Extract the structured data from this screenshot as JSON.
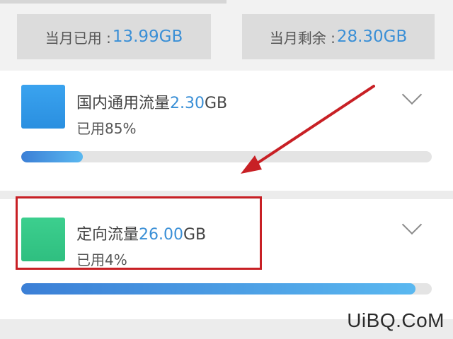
{
  "summary": {
    "used_label": "当月已用 :",
    "used_value": "13.99GB",
    "left_label": "当月剩余 :",
    "left_value": "28.30GB"
  },
  "cards": [
    {
      "title": "国内通用流量",
      "amount": "2.30",
      "unit": "GB",
      "usage_label": "已用85%",
      "icon_color": "#2a8fe0"
    },
    {
      "title": "定向流量",
      "amount": "26.00",
      "unit": "GB",
      "usage_label": "已用4%",
      "icon_color": "#2fbf80"
    }
  ],
  "colors": {
    "accent": "#3a8fd6",
    "highlight": "#c82025"
  },
  "watermark": "UiBQ.CoM"
}
